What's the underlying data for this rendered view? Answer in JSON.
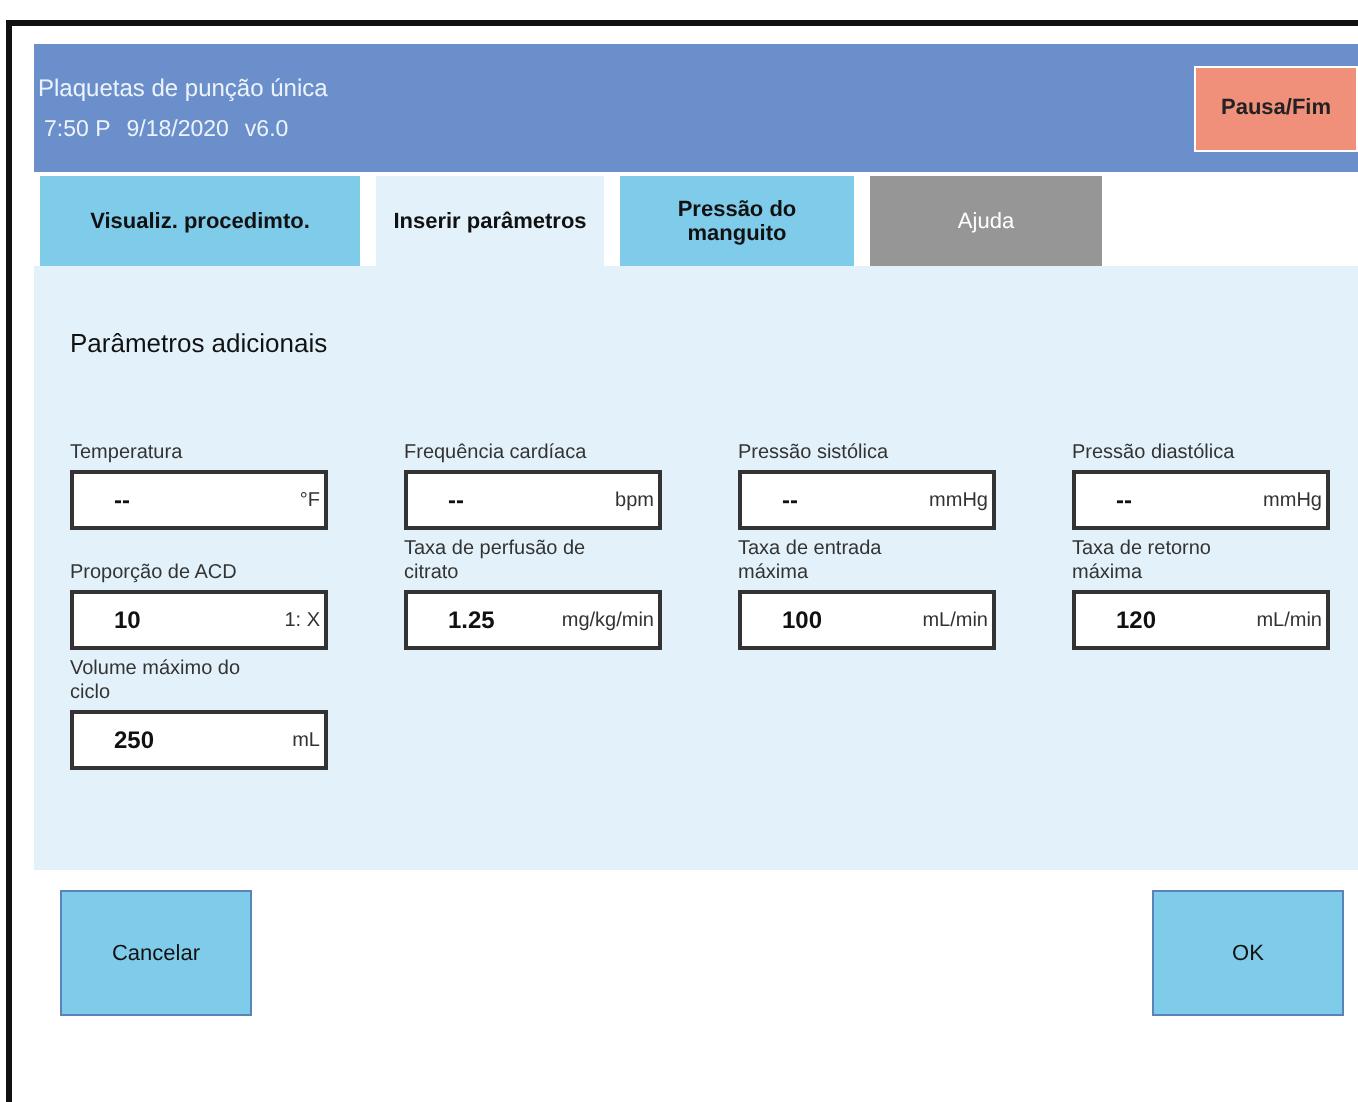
{
  "header": {
    "title": "Plaquetas de punção única",
    "time": "7:50 P",
    "date": "9/18/2020",
    "version": "v6.0",
    "action_button": "Pausa/Fim"
  },
  "tabs": [
    {
      "label": "Visualiz. procedimto.",
      "selected": false,
      "disabled": false
    },
    {
      "label": "Inserir parâmetros",
      "selected": true,
      "disabled": false
    },
    {
      "label": "Pressão do manguito",
      "selected": false,
      "disabled": false
    },
    {
      "label": "Ajuda",
      "selected": false,
      "disabled": true
    }
  ],
  "panel": {
    "title": "Parâmetros adicionais",
    "fields": [
      {
        "label": "Temperatura",
        "value": "--",
        "unit": "°F"
      },
      {
        "label": "Frequência cardíaca",
        "value": "--",
        "unit": "bpm"
      },
      {
        "label": "Pressão sistólica",
        "value": "--",
        "unit": "mmHg"
      },
      {
        "label": "Pressão diastólica",
        "value": "--",
        "unit": "mmHg"
      },
      {
        "label": "Proporção de ACD",
        "value": "10",
        "unit": "1: X"
      },
      {
        "label": "Taxa de perfusão de citrato",
        "value": "1.25",
        "unit": "mg/kg/min"
      },
      {
        "label": "Taxa de entrada máxima",
        "value": "100",
        "unit": "mL/min"
      },
      {
        "label": "Taxa de retorno máxima",
        "value": "120",
        "unit": "mL/min"
      },
      {
        "label": "Volume máximo do ciclo",
        "value": "250",
        "unit": "mL"
      }
    ]
  },
  "buttons": [
    {
      "label": "Cancelar"
    },
    {
      "label": "OK"
    }
  ]
}
